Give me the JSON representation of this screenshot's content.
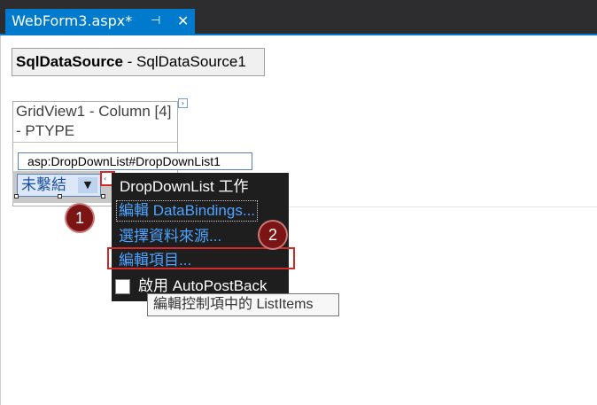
{
  "tab": {
    "title": "WebForm3.aspx*",
    "pin_glyph": "⊣",
    "close_glyph": "✕"
  },
  "sqldatasource": {
    "type_label": "SqlDataSource",
    "separator": " - ",
    "instance": "SqlDataSource1"
  },
  "gridview": {
    "title": "GridView1 - Column [4] - PTYPE",
    "smarttag_glyph": "›"
  },
  "dropdown": {
    "control_label": "asp:DropDownList#DropDownList1",
    "selected_text": "未繫結",
    "arrow_glyph": "▼",
    "smarttag_glyph": "‹"
  },
  "badges": [
    "1",
    "2"
  ],
  "tasks_panel": {
    "title": "DropDownList 工作",
    "items": [
      "編輯 DataBindings...",
      "選擇資料來源...",
      "編輯項目..."
    ],
    "autopostback_label": "啟用 AutoPostBack",
    "autopostback_checked": false
  },
  "tooltip": {
    "text": "編輯控制項中的 ListItems"
  },
  "colors": {
    "accent": "#007acc",
    "highlight_border": "#d12a2a",
    "badge": "#7b1515",
    "panel_bg": "#1e1e1e",
    "link": "#4da3ff"
  }
}
